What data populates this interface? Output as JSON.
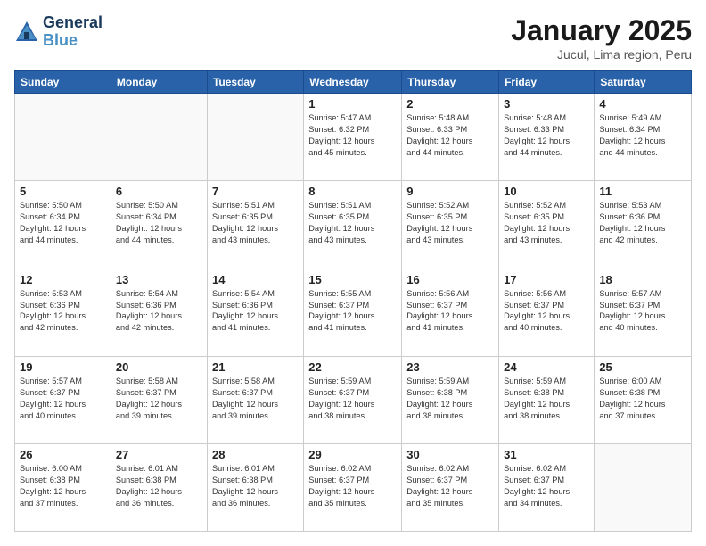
{
  "header": {
    "logo_line1": "General",
    "logo_line2": "Blue",
    "month_title": "January 2025",
    "subtitle": "Jucul, Lima region, Peru"
  },
  "days_of_week": [
    "Sunday",
    "Monday",
    "Tuesday",
    "Wednesday",
    "Thursday",
    "Friday",
    "Saturday"
  ],
  "weeks": [
    [
      {
        "day": "",
        "info": ""
      },
      {
        "day": "",
        "info": ""
      },
      {
        "day": "",
        "info": ""
      },
      {
        "day": "1",
        "info": "Sunrise: 5:47 AM\nSunset: 6:32 PM\nDaylight: 12 hours\nand 45 minutes."
      },
      {
        "day": "2",
        "info": "Sunrise: 5:48 AM\nSunset: 6:33 PM\nDaylight: 12 hours\nand 44 minutes."
      },
      {
        "day": "3",
        "info": "Sunrise: 5:48 AM\nSunset: 6:33 PM\nDaylight: 12 hours\nand 44 minutes."
      },
      {
        "day": "4",
        "info": "Sunrise: 5:49 AM\nSunset: 6:34 PM\nDaylight: 12 hours\nand 44 minutes."
      }
    ],
    [
      {
        "day": "5",
        "info": "Sunrise: 5:50 AM\nSunset: 6:34 PM\nDaylight: 12 hours\nand 44 minutes."
      },
      {
        "day": "6",
        "info": "Sunrise: 5:50 AM\nSunset: 6:34 PM\nDaylight: 12 hours\nand 44 minutes."
      },
      {
        "day": "7",
        "info": "Sunrise: 5:51 AM\nSunset: 6:35 PM\nDaylight: 12 hours\nand 43 minutes."
      },
      {
        "day": "8",
        "info": "Sunrise: 5:51 AM\nSunset: 6:35 PM\nDaylight: 12 hours\nand 43 minutes."
      },
      {
        "day": "9",
        "info": "Sunrise: 5:52 AM\nSunset: 6:35 PM\nDaylight: 12 hours\nand 43 minutes."
      },
      {
        "day": "10",
        "info": "Sunrise: 5:52 AM\nSunset: 6:35 PM\nDaylight: 12 hours\nand 43 minutes."
      },
      {
        "day": "11",
        "info": "Sunrise: 5:53 AM\nSunset: 6:36 PM\nDaylight: 12 hours\nand 42 minutes."
      }
    ],
    [
      {
        "day": "12",
        "info": "Sunrise: 5:53 AM\nSunset: 6:36 PM\nDaylight: 12 hours\nand 42 minutes."
      },
      {
        "day": "13",
        "info": "Sunrise: 5:54 AM\nSunset: 6:36 PM\nDaylight: 12 hours\nand 42 minutes."
      },
      {
        "day": "14",
        "info": "Sunrise: 5:54 AM\nSunset: 6:36 PM\nDaylight: 12 hours\nand 41 minutes."
      },
      {
        "day": "15",
        "info": "Sunrise: 5:55 AM\nSunset: 6:37 PM\nDaylight: 12 hours\nand 41 minutes."
      },
      {
        "day": "16",
        "info": "Sunrise: 5:56 AM\nSunset: 6:37 PM\nDaylight: 12 hours\nand 41 minutes."
      },
      {
        "day": "17",
        "info": "Sunrise: 5:56 AM\nSunset: 6:37 PM\nDaylight: 12 hours\nand 40 minutes."
      },
      {
        "day": "18",
        "info": "Sunrise: 5:57 AM\nSunset: 6:37 PM\nDaylight: 12 hours\nand 40 minutes."
      }
    ],
    [
      {
        "day": "19",
        "info": "Sunrise: 5:57 AM\nSunset: 6:37 PM\nDaylight: 12 hours\nand 40 minutes."
      },
      {
        "day": "20",
        "info": "Sunrise: 5:58 AM\nSunset: 6:37 PM\nDaylight: 12 hours\nand 39 minutes."
      },
      {
        "day": "21",
        "info": "Sunrise: 5:58 AM\nSunset: 6:37 PM\nDaylight: 12 hours\nand 39 minutes."
      },
      {
        "day": "22",
        "info": "Sunrise: 5:59 AM\nSunset: 6:37 PM\nDaylight: 12 hours\nand 38 minutes."
      },
      {
        "day": "23",
        "info": "Sunrise: 5:59 AM\nSunset: 6:38 PM\nDaylight: 12 hours\nand 38 minutes."
      },
      {
        "day": "24",
        "info": "Sunrise: 5:59 AM\nSunset: 6:38 PM\nDaylight: 12 hours\nand 38 minutes."
      },
      {
        "day": "25",
        "info": "Sunrise: 6:00 AM\nSunset: 6:38 PM\nDaylight: 12 hours\nand 37 minutes."
      }
    ],
    [
      {
        "day": "26",
        "info": "Sunrise: 6:00 AM\nSunset: 6:38 PM\nDaylight: 12 hours\nand 37 minutes."
      },
      {
        "day": "27",
        "info": "Sunrise: 6:01 AM\nSunset: 6:38 PM\nDaylight: 12 hours\nand 36 minutes."
      },
      {
        "day": "28",
        "info": "Sunrise: 6:01 AM\nSunset: 6:38 PM\nDaylight: 12 hours\nand 36 minutes."
      },
      {
        "day": "29",
        "info": "Sunrise: 6:02 AM\nSunset: 6:37 PM\nDaylight: 12 hours\nand 35 minutes."
      },
      {
        "day": "30",
        "info": "Sunrise: 6:02 AM\nSunset: 6:37 PM\nDaylight: 12 hours\nand 35 minutes."
      },
      {
        "day": "31",
        "info": "Sunrise: 6:02 AM\nSunset: 6:37 PM\nDaylight: 12 hours\nand 34 minutes."
      },
      {
        "day": "",
        "info": ""
      }
    ]
  ]
}
